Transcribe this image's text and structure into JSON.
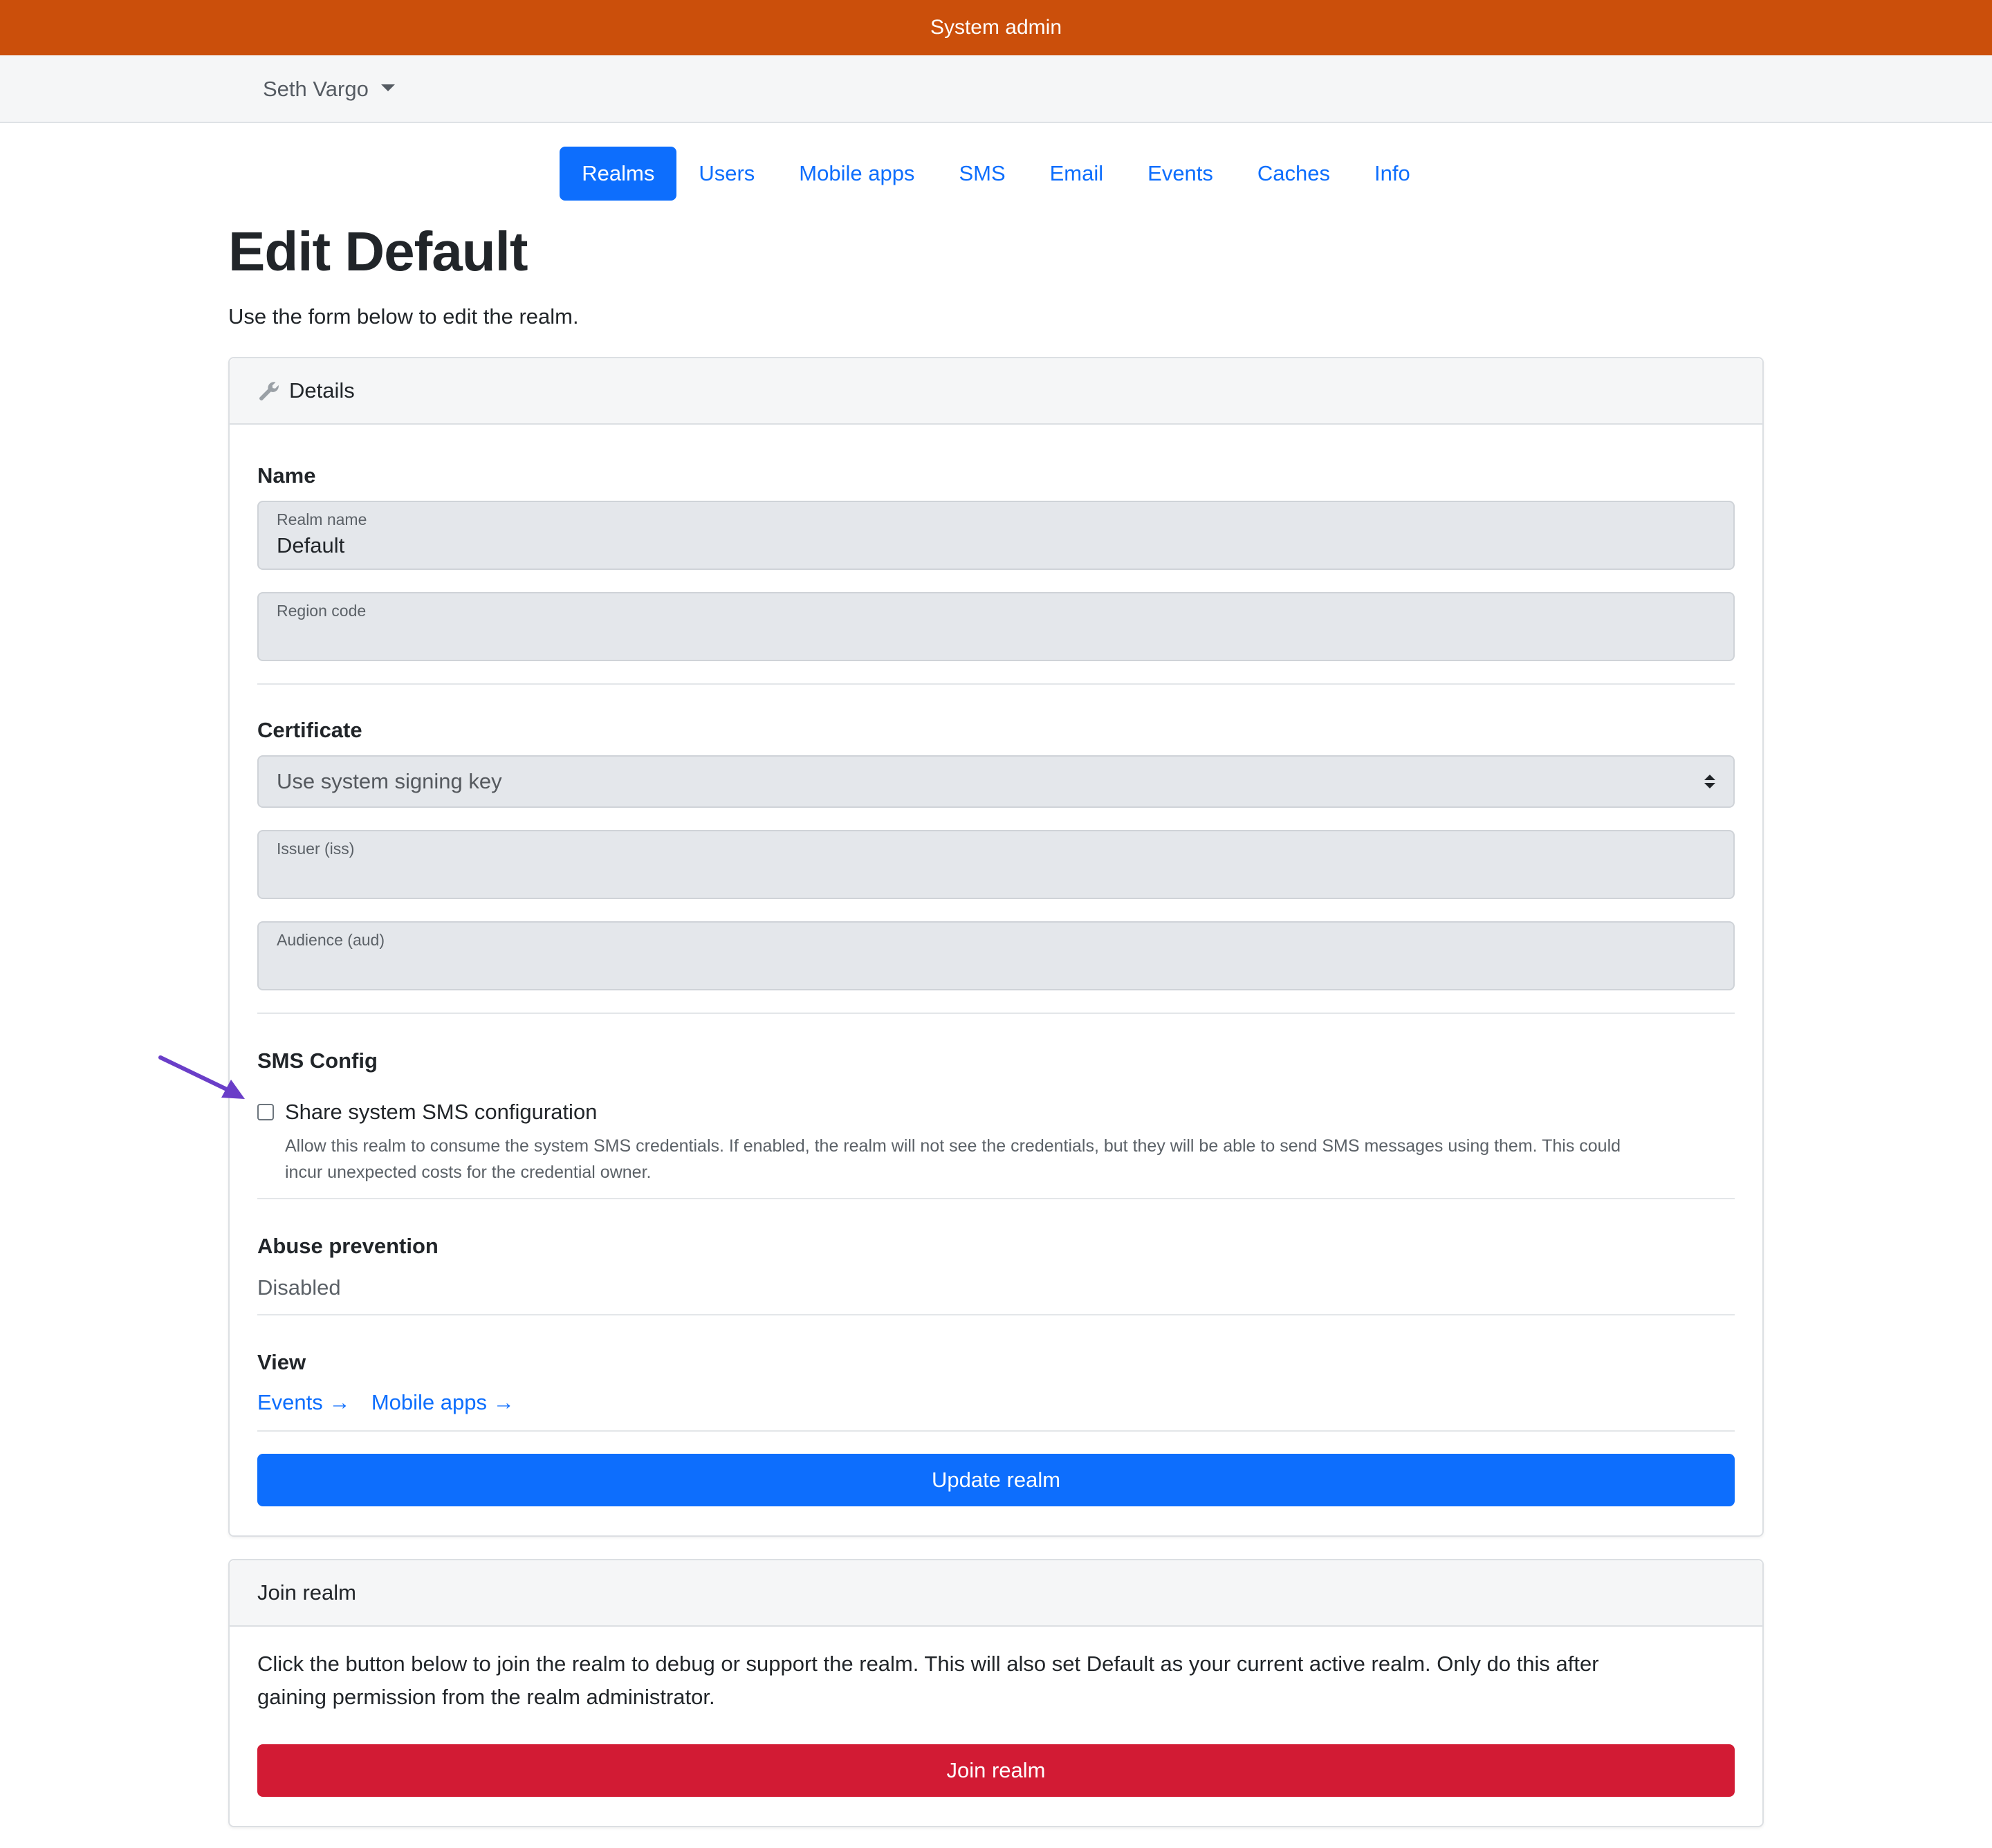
{
  "topbar": {
    "title": "System admin"
  },
  "user_menu": {
    "name": "Seth Vargo"
  },
  "nav": {
    "items": [
      "Realms",
      "Users",
      "Mobile apps",
      "SMS",
      "Email",
      "Events",
      "Caches",
      "Info"
    ],
    "active": "Realms"
  },
  "page": {
    "title": "Edit Default",
    "subtitle": "Use the form below to edit the realm."
  },
  "details": {
    "header": "Details",
    "name_section": "Name",
    "realm_name_label": "Realm name",
    "realm_name_value": "Default",
    "region_code_label": "Region code",
    "region_code_value": "",
    "certificate_section": "Certificate",
    "certificate_select": "Use system signing key",
    "issuer_label": "Issuer (iss)",
    "issuer_value": "",
    "audience_label": "Audience (aud)",
    "audience_value": "",
    "sms_section": "SMS Config",
    "share_sms_label": "Share system SMS configuration",
    "share_sms_checked": false,
    "share_sms_help_1": "Allow this realm to consume the system SMS credentials. If enabled, the realm will not see the credentials, but they will be able to send SMS messages using them. This could",
    "share_sms_help_2": "incur unexpected costs for the credential owner.",
    "abuse_section": "Abuse prevention",
    "abuse_value": "Disabled",
    "view_section": "View",
    "view_links": [
      "Events →",
      "Mobile apps →"
    ],
    "update_button": "Update realm"
  },
  "join": {
    "header": "Join realm",
    "text_1": "Click the button below to join the realm to debug or support the realm. This will also set Default as your current active realm. Only do this after",
    "text_2": "gaining permission from the realm administrator.",
    "button": "Join realm"
  },
  "colors": {
    "topbar": "#cb4f0b",
    "primary": "#0d6efd",
    "danger": "#d21b34",
    "annotation_arrow": "#6a3ec8"
  }
}
